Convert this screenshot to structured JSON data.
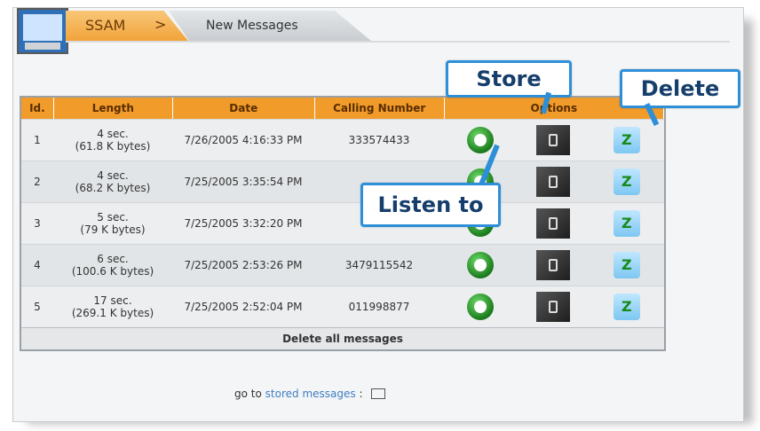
{
  "tabs": {
    "active_label": "SSAM",
    "active_separator": ">",
    "second_label": "New Messages"
  },
  "table": {
    "headers": [
      "Id.",
      "Length",
      "Date",
      "Calling Number",
      "Options"
    ],
    "rows": [
      {
        "id": "1",
        "length": "4 sec.",
        "size": "(61.8 K bytes)",
        "date": "7/26/2005 4:16:33 PM",
        "number": "333574433"
      },
      {
        "id": "2",
        "length": "4 sec.",
        "size": "(68.2 K bytes)",
        "date": "7/25/2005 3:35:54 PM",
        "number": ""
      },
      {
        "id": "3",
        "length": "5 sec.",
        "size": "(79 K bytes)",
        "date": "7/25/2005 3:32:20 PM",
        "number": ""
      },
      {
        "id": "4",
        "length": "6 sec.",
        "size": "(100.6 K bytes)",
        "date": "7/25/2005 2:53:26 PM",
        "number": "3479115542"
      },
      {
        "id": "5",
        "length": "17 sec.",
        "size": "(269.1 K bytes)",
        "date": "7/25/2005 2:52:04 PM",
        "number": "011998877"
      }
    ],
    "footer_label": "Delete all messages"
  },
  "callouts": {
    "store": "Store",
    "delete": "Delete",
    "listen": "Listen to"
  },
  "goto": {
    "prefix": "go to",
    "link": "stored messages",
    "suffix": ":"
  },
  "icons": {
    "app": "app-monitor-icon",
    "listen": "play-icon",
    "store": "store-icon",
    "delete": "delete-icon",
    "mail": "mail-icon"
  },
  "colors": {
    "accent": "#f09b2a",
    "callout_border": "#2d8fd8"
  }
}
